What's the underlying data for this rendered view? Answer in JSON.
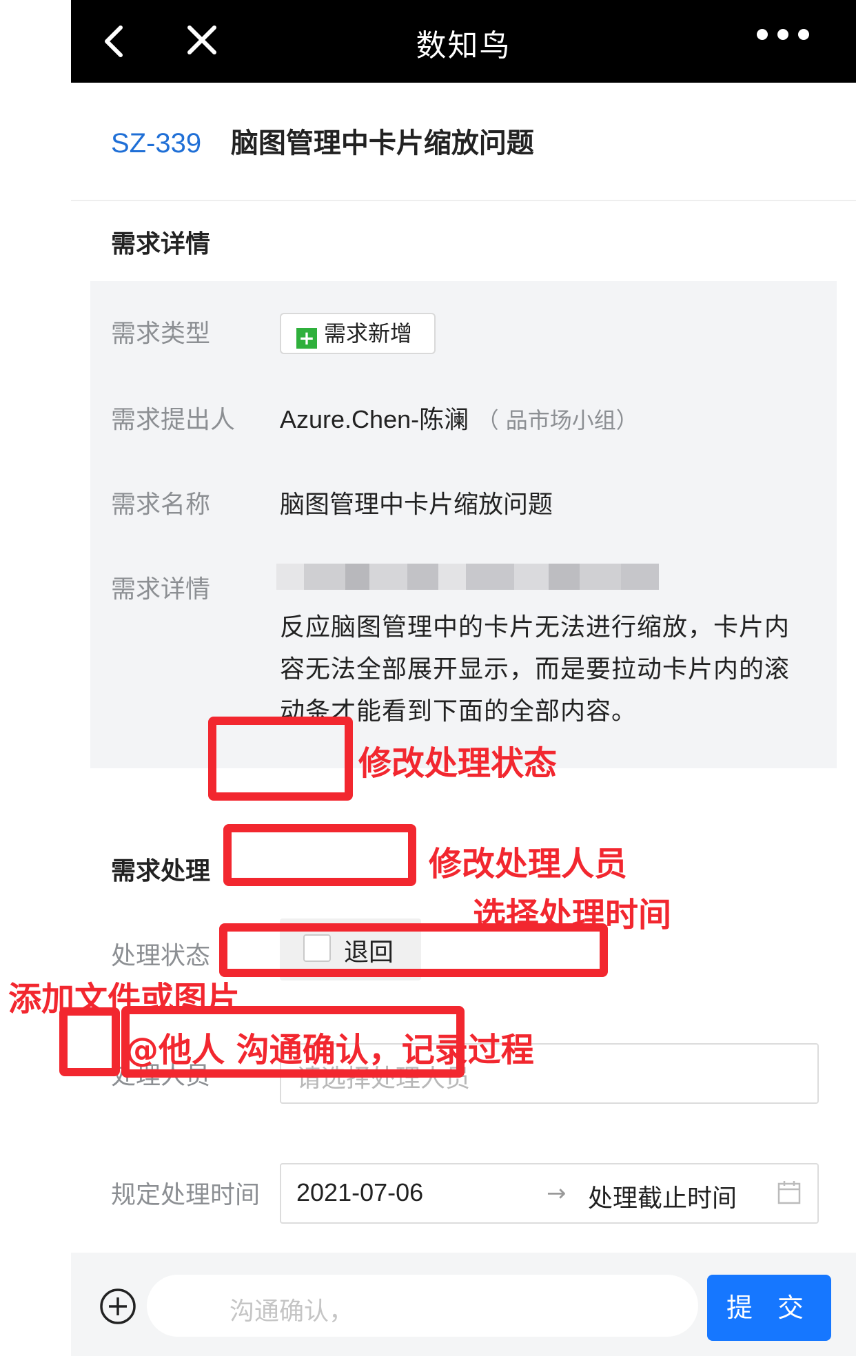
{
  "topbar": {
    "title": "数知鸟"
  },
  "header": {
    "id": "SZ-339",
    "name": "脑图管理中卡片缩放问题"
  },
  "details": {
    "section_title": "需求详情",
    "type_label": "需求类型",
    "type_value": "需求新增",
    "proposer_label": "需求提出人",
    "proposer_value": "Azure.Chen-陈澜",
    "proposer_group": "（ 品市场小组）",
    "name_label": "需求名称",
    "name_value": "脑图管理中卡片缩放问题",
    "detail_label": "需求详情",
    "detail_value": "反应脑图管理中的卡片无法进行缩放，卡片内容无法全部展开显示，而是要拉动卡片内的滚动条才能看到下面的全部内容。"
  },
  "processing": {
    "section_title": "需求处理",
    "status_label": "处理状态",
    "status_option": "退回",
    "handler_label": "处理人员",
    "handler_placeholder": "请选择处理人员",
    "deadline_label": "规定处理时间",
    "start_date": "2021-07-06",
    "arrow": "→",
    "end_placeholder": "处理截止时间"
  },
  "bottom": {
    "comment_placeholder": "沟通确认，",
    "submit_label": "提 交"
  },
  "annotations": {
    "status": "修改处理状态",
    "handler": "修改处理人员",
    "time": "选择处理时间",
    "attach": "添加文件或图片",
    "comment": "@他人 沟通确认，记录过程"
  },
  "colors": {
    "accent": "#1677ff",
    "annotation": "#f2272f",
    "tag_green": "#2fb03c"
  }
}
